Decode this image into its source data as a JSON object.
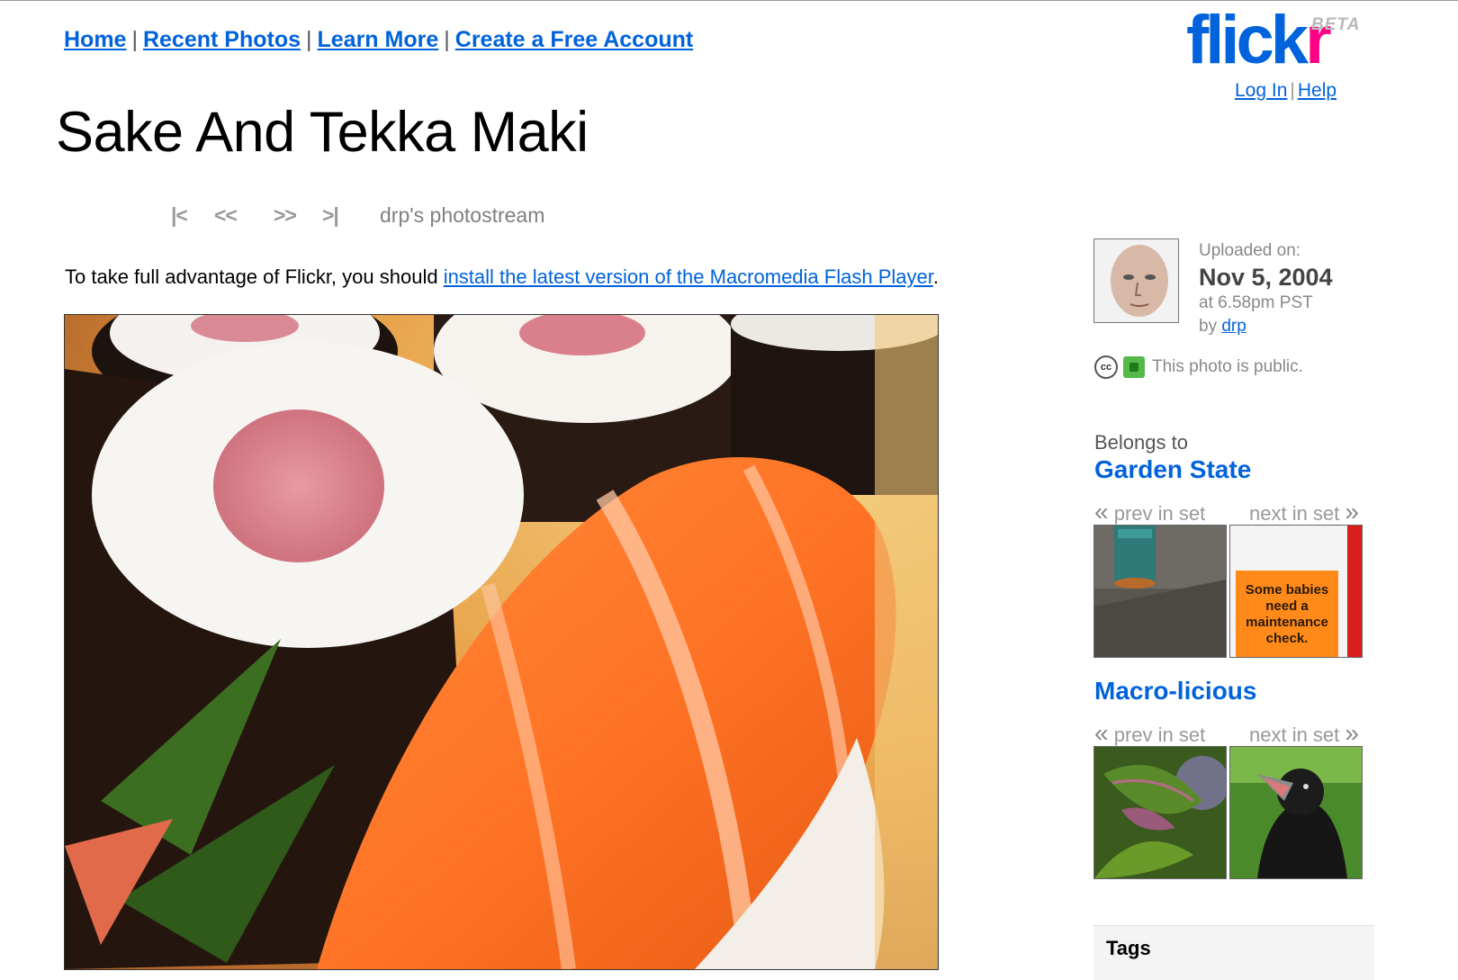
{
  "nav": {
    "home": "Home",
    "recent": "Recent Photos",
    "learn": "Learn More",
    "create": "Create a Free Account",
    "sep": "|"
  },
  "logo": {
    "flick": "flick",
    "r": "r",
    "beta": "BETA"
  },
  "user_links": {
    "login": "Log In",
    "help": "Help",
    "sep": "|"
  },
  "photo": {
    "title": "Sake And Tekka Maki",
    "nav": {
      "first": "|<",
      "prev": "<<",
      "next": ">>",
      "last": ">|",
      "stream": "drp's photostream"
    }
  },
  "flash_notice": {
    "text": "To take full advantage of Flickr, you should ",
    "link": "install the latest version of the Macromedia Flash Player",
    "end": "."
  },
  "upload": {
    "label": "Uploaded on:",
    "date": "Nov 5, 2004",
    "time": "at 6.58pm PST",
    "by": "by ",
    "user": "drp"
  },
  "privacy": {
    "cc": "cc",
    "text": "This photo is public."
  },
  "sets": {
    "belongs": "Belongs to",
    "items": [
      {
        "name": "Garden State",
        "prev": "prev in set",
        "next": "next in set"
      },
      {
        "name": "Macro-licious",
        "prev": "prev in set",
        "next": "next in set"
      }
    ],
    "prev_glyph": "«",
    "next_glyph": "»"
  },
  "thumb_sign": {
    "l1": "Some babies",
    "l2": "need a",
    "l3": "maintenance",
    "l4": "check."
  },
  "tags": {
    "heading": "Tags"
  },
  "colors": {
    "link": "#0063dc",
    "brand_pink": "#ff0084",
    "salmon": "#ff7a2e",
    "nori": "#2a1a14"
  }
}
